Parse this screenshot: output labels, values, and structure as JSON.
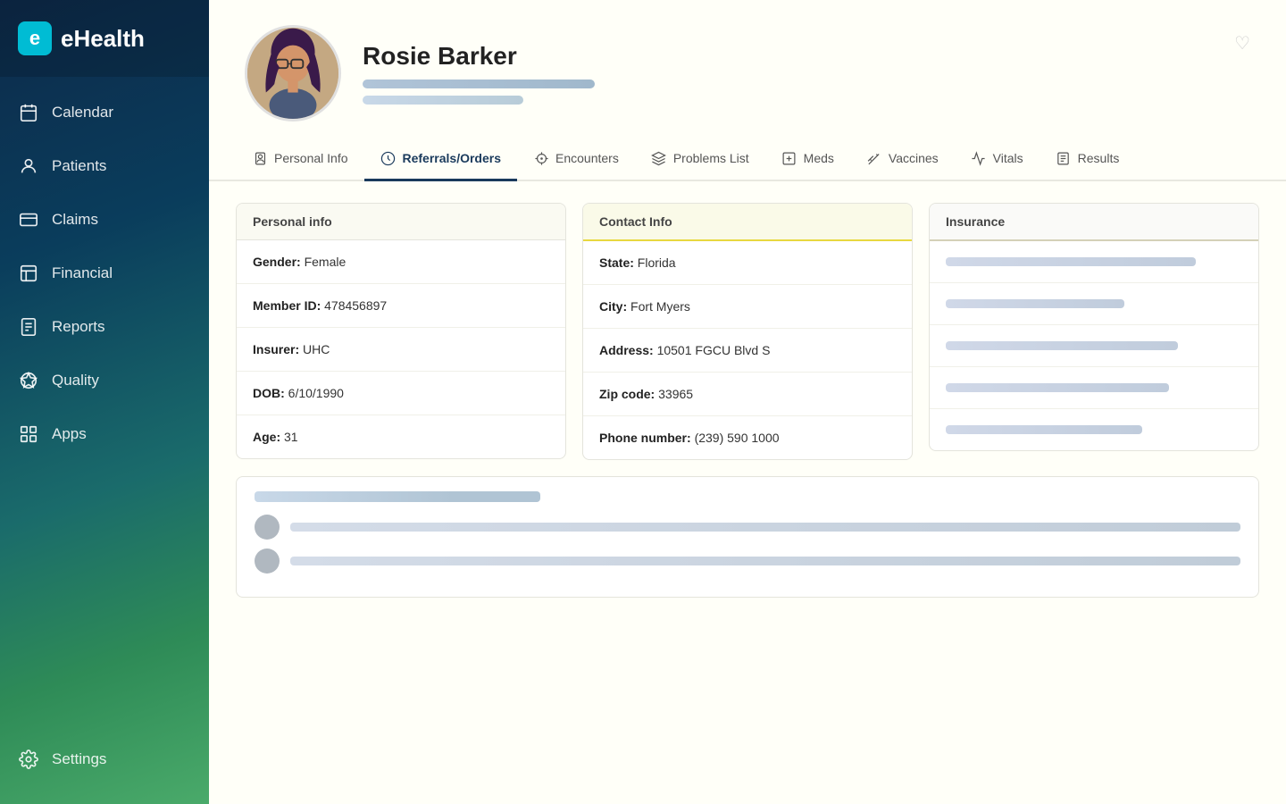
{
  "app": {
    "name": "eHealth",
    "logo_letter": "e"
  },
  "sidebar": {
    "items": [
      {
        "id": "calendar",
        "label": "Calendar",
        "icon": "calendar"
      },
      {
        "id": "patients",
        "label": "Patients",
        "icon": "patients"
      },
      {
        "id": "claims",
        "label": "Claims",
        "icon": "claims"
      },
      {
        "id": "financial",
        "label": "Financial",
        "icon": "financial"
      },
      {
        "id": "reports",
        "label": "Reports",
        "icon": "reports"
      },
      {
        "id": "quality",
        "label": "Quality",
        "icon": "quality"
      },
      {
        "id": "apps",
        "label": "Apps",
        "icon": "apps"
      },
      {
        "id": "settings",
        "label": "Settings",
        "icon": "settings"
      }
    ]
  },
  "patient": {
    "name": "Rosie Barker",
    "gender_label": "Gender:",
    "gender_value": "Female",
    "member_id_label": "Member ID:",
    "member_id_value": "478456897",
    "insurer_label": "Insurer:",
    "insurer_value": "UHC",
    "dob_label": "DOB:",
    "dob_value": "6/10/1990",
    "age_label": "Age:",
    "age_value": "31",
    "state_label": "State:",
    "state_value": "Florida",
    "city_label": "City:",
    "city_value": "Fort Myers",
    "address_label": "Address:",
    "address_value": "10501 FGCU Blvd S",
    "zip_label": "Zip code:",
    "zip_value": "33965",
    "phone_label": "Phone number:",
    "phone_value": "(239) 590 1000"
  },
  "tabs": [
    {
      "id": "personal-info",
      "label": "Personal Info",
      "active": false
    },
    {
      "id": "referrals-orders",
      "label": "Referrals/Orders",
      "active": true
    },
    {
      "id": "encounters",
      "label": "Encounters",
      "active": false
    },
    {
      "id": "problems-list",
      "label": "Problems List",
      "active": false
    },
    {
      "id": "meds",
      "label": "Meds",
      "active": false
    },
    {
      "id": "vaccines",
      "label": "Vaccines",
      "active": false
    },
    {
      "id": "vitals",
      "label": "Vitals",
      "active": false
    },
    {
      "id": "results",
      "label": "Results",
      "active": false
    }
  ],
  "sections": {
    "personal_info": "Personal info",
    "contact_info": "Contact Info",
    "insurance": "Insurance"
  }
}
